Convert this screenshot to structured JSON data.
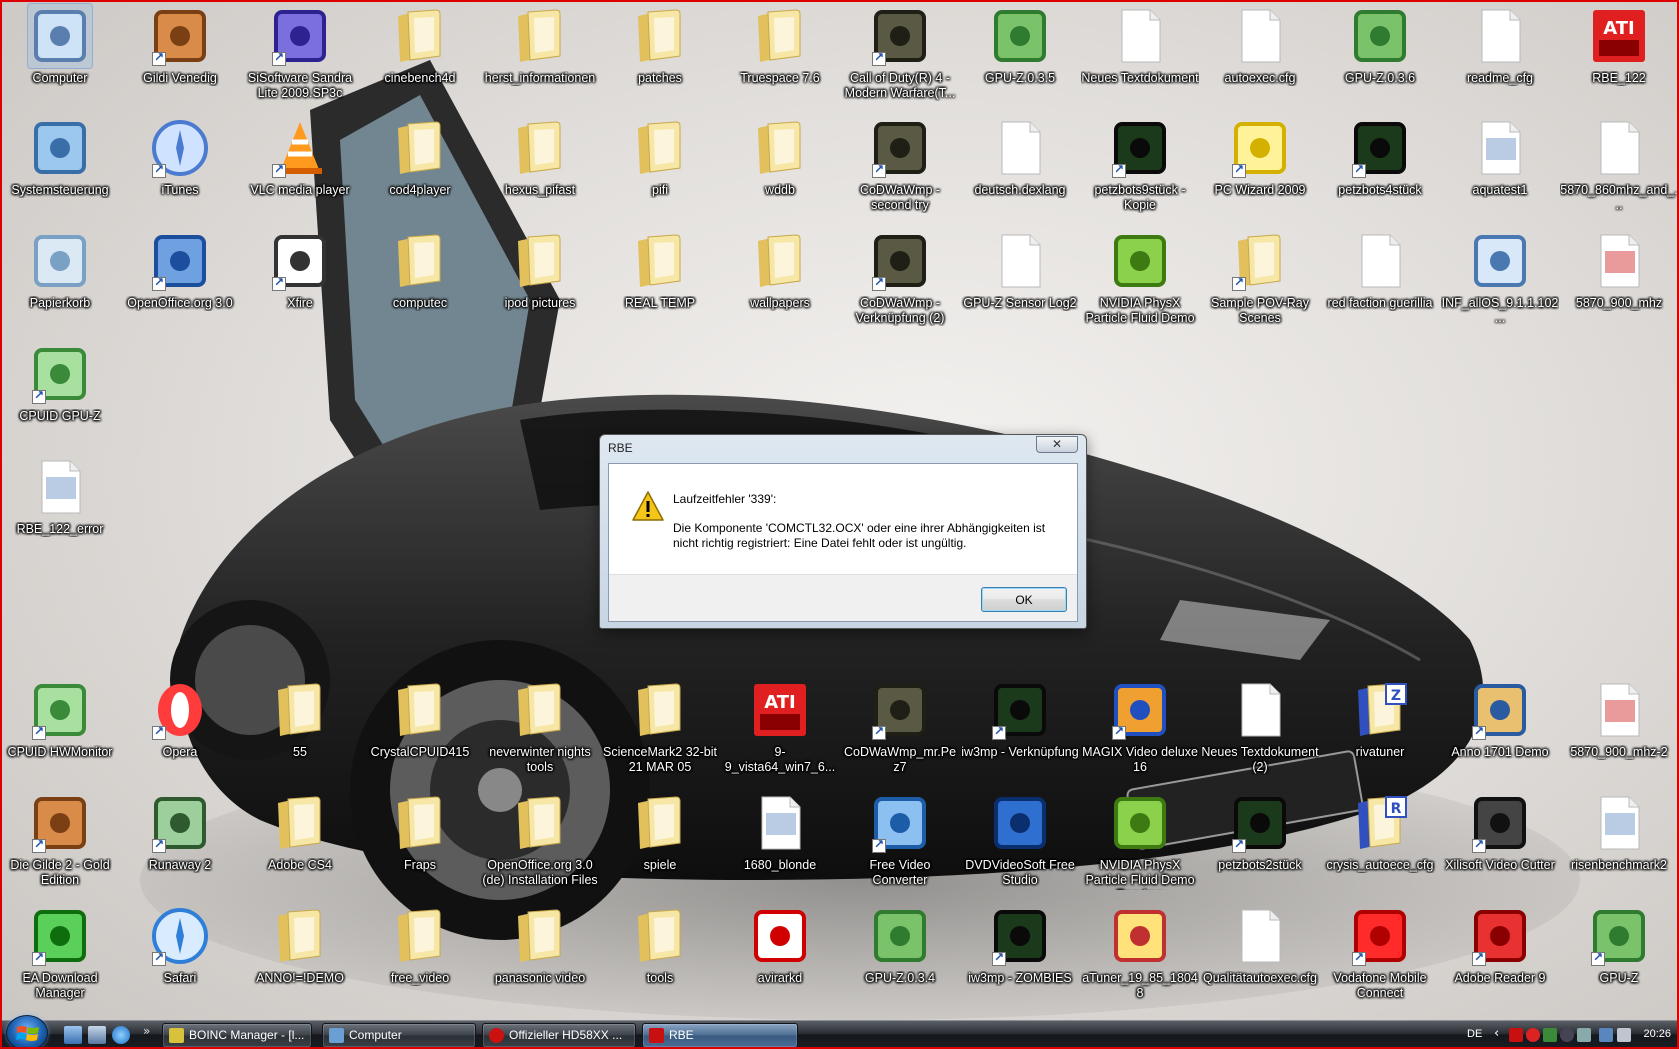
{
  "desktop": {
    "icons": [
      {
        "label": "Computer",
        "icon": "computer-icon",
        "shortcut": false,
        "selected": true
      },
      {
        "label": "Gildi Venedig",
        "icon": "ships-wheel-icon",
        "shortcut": true
      },
      {
        "label": "SiSoftware Sandra Lite 2009.SP3c",
        "icon": "sandra-info-icon",
        "shortcut": true
      },
      {
        "label": "cinebench4d",
        "icon": "folder-icon",
        "shortcut": false
      },
      {
        "label": "herst_informationen",
        "icon": "folder-icon",
        "shortcut": false
      },
      {
        "label": "patches",
        "icon": "folder-icon",
        "shortcut": false
      },
      {
        "label": "Truespace 7.6",
        "icon": "folder-icon",
        "shortcut": false
      },
      {
        "label": "Call of Duty(R) 4 - Modern Warfare(T...",
        "icon": "call-of-duty-icon",
        "shortcut": true
      },
      {
        "label": "GPU-Z.0.3.5",
        "icon": "gpu-z-icon",
        "shortcut": false
      },
      {
        "label": "Neues Textdokument",
        "icon": "text-document-icon",
        "shortcut": false
      },
      {
        "label": "autoexec.cfg",
        "icon": "text-document-icon",
        "shortcut": false
      },
      {
        "label": "GPU-Z.0.3.6",
        "icon": "gpu-z-icon",
        "shortcut": false
      },
      {
        "label": "readme_cfg",
        "icon": "text-document-icon",
        "shortcut": false
      },
      {
        "label": "RBE_122",
        "icon": "ati-rbe-icon",
        "shortcut": false
      },
      {
        "label": "Systemsteuerung",
        "icon": "control-panel-icon",
        "shortcut": false
      },
      {
        "label": "iTunes",
        "icon": "itunes-icon",
        "shortcut": true
      },
      {
        "label": "VLC media player",
        "icon": "vlc-icon",
        "shortcut": true
      },
      {
        "label": "cod4player",
        "icon": "folder-icon",
        "shortcut": false
      },
      {
        "label": "hexus_pifast",
        "icon": "folder-icon",
        "shortcut": false
      },
      {
        "label": "pifi",
        "icon": "folder-icon",
        "shortcut": false
      },
      {
        "label": "wddb",
        "icon": "folder-icon",
        "shortcut": false
      },
      {
        "label": "CoDWaWmp - second try",
        "icon": "call-of-duty-icon",
        "shortcut": true
      },
      {
        "label": "deutsch.dexlang",
        "icon": "text-document-icon",
        "shortcut": false
      },
      {
        "label": "petzbots9stück - Kopie",
        "icon": "petzbots-icon",
        "shortcut": true
      },
      {
        "label": "PC Wizard 2009",
        "icon": "pc-wizard-icon",
        "shortcut": true
      },
      {
        "label": "petzbots4stück",
        "icon": "petzbots-icon",
        "shortcut": true
      },
      {
        "label": "aquatest1",
        "icon": "image-file-icon",
        "shortcut": false
      },
      {
        "label": "5870_860mhz_and_...",
        "icon": "text-document-icon",
        "shortcut": false
      },
      {
        "label": "Papierkorb",
        "icon": "recycle-bin-icon",
        "shortcut": false
      },
      {
        "label": "OpenOffice.org 3.0",
        "icon": "openoffice-icon",
        "shortcut": true
      },
      {
        "label": "Xfire",
        "icon": "xfire-icon",
        "shortcut": true
      },
      {
        "label": "computec",
        "icon": "folder-icon",
        "shortcut": false
      },
      {
        "label": "ipod pictures",
        "icon": "folder-icon",
        "shortcut": false
      },
      {
        "label": "REAL TEMP",
        "icon": "folder-icon",
        "shortcut": false
      },
      {
        "label": "wallpapers",
        "icon": "folder-icon",
        "shortcut": false
      },
      {
        "label": "CoDWaWmp - Verknüpfung (2)",
        "icon": "call-of-duty-icon",
        "shortcut": true
      },
      {
        "label": "GPU-Z Sensor Log2",
        "icon": "text-document-icon",
        "shortcut": false
      },
      {
        "label": "NVIDIA PhysX Particle Fluid Demo",
        "icon": "nvidia-icon",
        "shortcut": false
      },
      {
        "label": "Sample POV-Ray Scenes",
        "icon": "folder-icon",
        "shortcut": true
      },
      {
        "label": "red faction guerillia",
        "icon": "text-document-icon",
        "shortcut": false
      },
      {
        "label": "INF_allOS_9.1.1.102...",
        "icon": "network-setup-icon",
        "shortcut": false
      },
      {
        "label": "5870_900_mhz",
        "icon": "screenshot-file-icon",
        "shortcut": false
      },
      {
        "label": "CPUID GPU-Z",
        "icon": "cpuid-icon",
        "shortcut": true
      },
      {
        "label": "RBE_122_error",
        "icon": "image-file-icon",
        "shortcut": false
      },
      {
        "label": "CPUID HWMonitor",
        "icon": "cpuid-icon",
        "shortcut": true
      },
      {
        "label": "Opera",
        "icon": "opera-icon",
        "shortcut": true
      },
      {
        "label": "55",
        "icon": "folder-icon",
        "shortcut": false
      },
      {
        "label": "CrystalCPUID415",
        "icon": "folder-icon",
        "shortcut": false
      },
      {
        "label": "neverwinter nights tools",
        "icon": "folder-icon",
        "shortcut": false
      },
      {
        "label": "ScienceMark2 32-bit 21 MAR 05",
        "icon": "folder-icon",
        "shortcut": false
      },
      {
        "label": "9-9_vista64_win7_6...",
        "icon": "ati-radeon-icon",
        "shortcut": false
      },
      {
        "label": "CoDWaWmp_mr.Pez7",
        "icon": "call-of-duty-icon",
        "shortcut": true
      },
      {
        "label": "iw3mp - Verknüpfung",
        "icon": "petzbots-icon",
        "shortcut": true
      },
      {
        "label": "MAGIX Video deluxe 16",
        "icon": "magix-icon",
        "shortcut": true
      },
      {
        "label": "Neues Textdokument (2)",
        "icon": "text-document-icon",
        "shortcut": false
      },
      {
        "label": "rivatuner",
        "icon": "zip-folder-icon",
        "shortcut": false
      },
      {
        "label": "Anno 1701 Demo",
        "icon": "anno-icon",
        "shortcut": true
      },
      {
        "label": "5870_900_mhz-2",
        "icon": "screenshot-file-icon",
        "shortcut": false
      },
      {
        "label": "Die Gilde 2 - Gold Edition",
        "icon": "ships-wheel-icon",
        "shortcut": true
      },
      {
        "label": "Runaway 2",
        "icon": "runaway-icon",
        "shortcut": true
      },
      {
        "label": "Adobe CS4",
        "icon": "folder-icon",
        "shortcut": false
      },
      {
        "label": "Fraps",
        "icon": "folder-icon",
        "shortcut": false
      },
      {
        "label": "OpenOffice.org 3.0 (de) Installation Files",
        "icon": "folder-icon",
        "shortcut": false
      },
      {
        "label": "spiele",
        "icon": "folder-icon",
        "shortcut": false
      },
      {
        "label": "1680_blonde",
        "icon": "image-file-icon",
        "shortcut": false
      },
      {
        "label": "Free Video Converter",
        "icon": "video-converter-icon",
        "shortcut": true
      },
      {
        "label": "DVDVideoSoft Free Studio",
        "icon": "dvdvideosoft-icon",
        "shortcut": false
      },
      {
        "label": "NVIDIA PhysX Particle Fluid Demo Readme",
        "icon": "nvidia-icon",
        "shortcut": false
      },
      {
        "label": "petzbots2stück",
        "icon": "petzbots-icon",
        "shortcut": true
      },
      {
        "label": "crysis_autoece_cfg",
        "icon": "rar-folder-icon",
        "shortcut": false
      },
      {
        "label": "Xilisoft Video Cutter",
        "icon": "clapper-icon",
        "shortcut": true
      },
      {
        "label": "risenbenchmark2",
        "icon": "image-file-icon",
        "shortcut": false
      },
      {
        "label": "EA Download Manager",
        "icon": "ea-icon",
        "shortcut": true
      },
      {
        "label": "Safari",
        "icon": "safari-icon",
        "shortcut": true
      },
      {
        "label": "ANNO!=!DEMO",
        "icon": "folder-icon",
        "shortcut": false
      },
      {
        "label": "free_video",
        "icon": "folder-icon",
        "shortcut": false
      },
      {
        "label": "panasonic video",
        "icon": "folder-icon",
        "shortcut": false
      },
      {
        "label": "tools",
        "icon": "folder-icon",
        "shortcut": false
      },
      {
        "label": "avirarkd",
        "icon": "avira-icon",
        "shortcut": false
      },
      {
        "label": "GPU-Z.0.3.4",
        "icon": "gpu-z-icon",
        "shortcut": false
      },
      {
        "label": "iw3mp - ZOMBIES",
        "icon": "petzbots-icon",
        "shortcut": true
      },
      {
        "label": "aTuner_19_85_18048",
        "icon": "atuner-icon",
        "shortcut": false
      },
      {
        "label": "Qualitätautoexec.cfg",
        "icon": "text-document-icon",
        "shortcut": false
      },
      {
        "label": "Vodafone Mobile Connect",
        "icon": "vodafone-icon",
        "shortcut": true
      },
      {
        "label": "Adobe Reader 9",
        "icon": "adobe-reader-icon",
        "shortcut": true
      },
      {
        "label": "GPU-Z",
        "icon": "gpu-z-icon",
        "shortcut": true
      }
    ]
  },
  "dialog": {
    "title": "RBE",
    "close_label": "✕",
    "error_title": "Laufzeitfehler '339':",
    "error_message": "Die Komponente 'COMCTL32.OCX' oder eine ihrer Abhängigkeiten ist nicht richtig registriert: Eine Datei fehlt oder ist ungültig.",
    "ok_label": "OK",
    "icon": "warning-icon"
  },
  "taskbar": {
    "quick_launch": [
      "show-desktop-icon",
      "switch-windows-icon",
      "internet-explorer-icon"
    ],
    "quick_launch_more": "»",
    "tasks": [
      {
        "label": "BOINC Manager - [l...",
        "icon": "boinc-icon",
        "active": false
      },
      {
        "label": "Computer",
        "icon": "explorer-icon",
        "active": false
      },
      {
        "label": "Offizieller HD58XX ...",
        "icon": "opera-icon",
        "active": false
      },
      {
        "label": "RBE",
        "icon": "ati-rbe-icon",
        "active": true
      }
    ],
    "tray": {
      "language": "DE",
      "chevron": "‹",
      "icons": [
        "ati-tray-icon",
        "avira-tray-icon",
        "gpu-tray-icon",
        "steam-tray-icon",
        "settings-tray-icon",
        "network-tray-icon",
        "volume-tray-icon"
      ],
      "clock": "20:26"
    }
  },
  "colors": {
    "folder": "#f1d98a",
    "taskbar": "#1a1e24",
    "dialog_frame": "#c7d5e4",
    "border_accent": "#dd0000"
  }
}
